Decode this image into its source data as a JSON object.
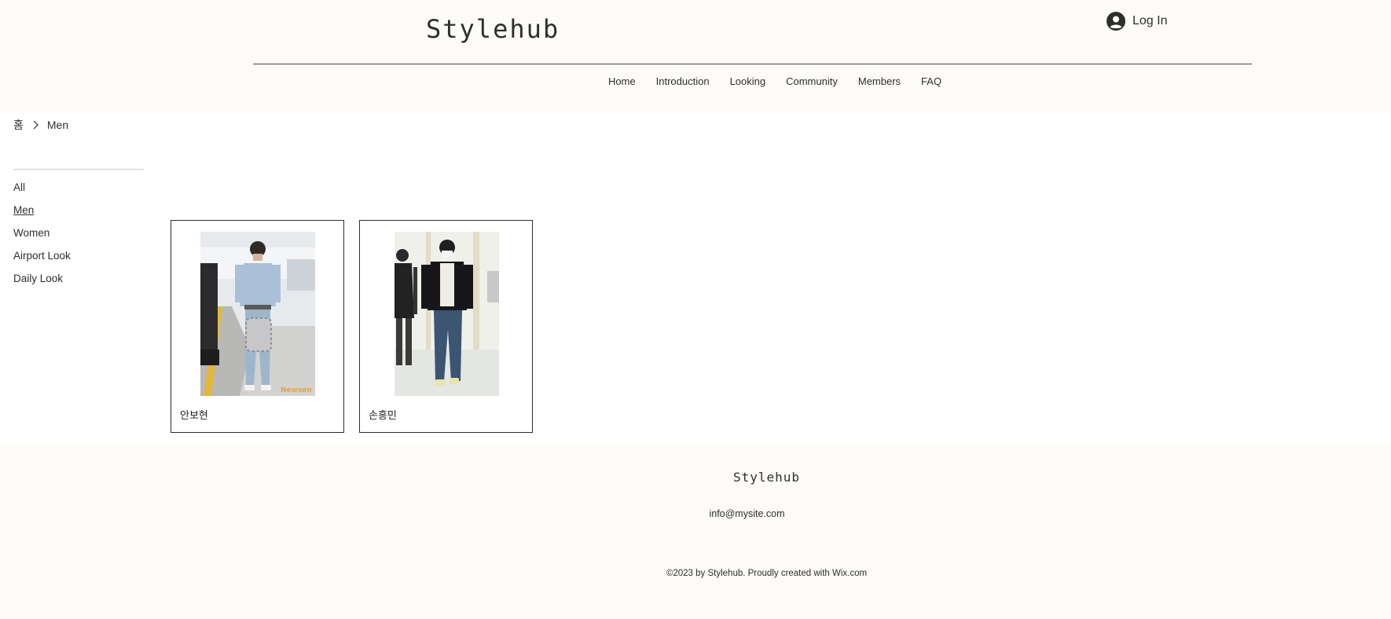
{
  "header": {
    "site_title": "Stylehub",
    "login_label": "Log In",
    "nav": [
      "Home",
      "Introduction",
      "Looking",
      "Community",
      "Members",
      "FAQ"
    ]
  },
  "breadcrumb": {
    "home": "홈",
    "current": "Men"
  },
  "sidebar": {
    "categories": [
      "All",
      "Men",
      "Women",
      "Airport Look",
      "Daily Look"
    ],
    "active": "Men"
  },
  "cards": [
    {
      "name": "안보현",
      "watermark": "Newsen"
    },
    {
      "name": "손흥민"
    }
  ],
  "footer": {
    "title": "Stylehub",
    "email": "info@mysite.com",
    "copyright": "©2023 by Stylehub. Proudly created with Wix.com"
  },
  "colors": {
    "background": "#fcfbf8",
    "text": "#2f2e2e"
  }
}
